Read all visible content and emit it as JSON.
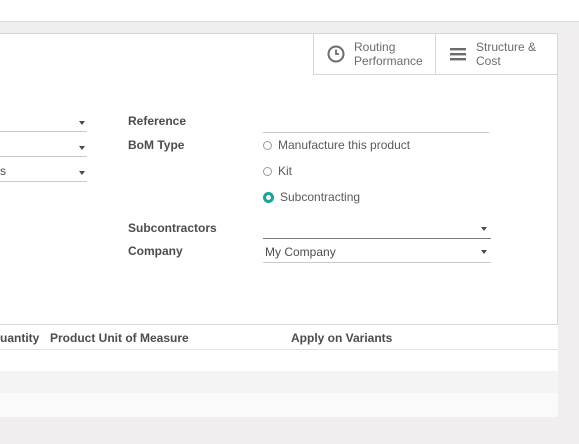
{
  "buttons": {
    "routing_label": "Routing\nPerformance",
    "structure_label": "Structure &\nCost"
  },
  "left_fields": {
    "third_value_fragment": "s"
  },
  "form": {
    "reference_label": "Reference",
    "reference_value": "",
    "bom_type_label": "BoM Type",
    "bom_type_options": [
      "Manufacture this product",
      "Kit",
      "Subcontracting"
    ],
    "bom_type_selected": "Subcontracting",
    "subcontractors_label": "Subcontractors",
    "subcontractors_value": "",
    "company_label": "Company",
    "company_value": "My Company"
  },
  "table": {
    "columns": [
      "uantity",
      "Product Unit of Measure",
      "Apply on Variants"
    ]
  },
  "colors": {
    "accent": "#15a39a",
    "text": "#4c4c4c",
    "border": "#d6d6d6"
  }
}
